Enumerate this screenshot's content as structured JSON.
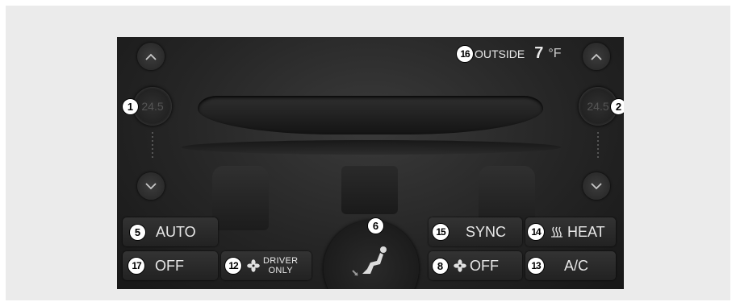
{
  "outside": {
    "label": "OUTSIDE",
    "value": "7",
    "unit": "°F",
    "badge": "16"
  },
  "driver_temp": {
    "value": "24.5",
    "badge": "1"
  },
  "passenger_temp": {
    "value": "24.5",
    "badge": "2"
  },
  "buttons": {
    "auto": {
      "label": "AUTO",
      "badge": "5"
    },
    "off": {
      "label": "OFF",
      "badge": "17"
    },
    "driver_only": {
      "line1": "DRIVER",
      "line2": "ONLY",
      "badge": "12"
    },
    "sync": {
      "label": "SYNC",
      "badge": "15"
    },
    "heat": {
      "label": "HEAT",
      "badge": "14"
    },
    "fan_off": {
      "label": "OFF",
      "badge": "8"
    },
    "ac": {
      "label": "A/C",
      "badge": "13"
    }
  },
  "vent_mode": {
    "badge": "6"
  },
  "icons": [
    "chevron-up-icon",
    "chevron-down-icon",
    "fan-icon",
    "rear-heat-icon",
    "airflow-seat-icon"
  ]
}
